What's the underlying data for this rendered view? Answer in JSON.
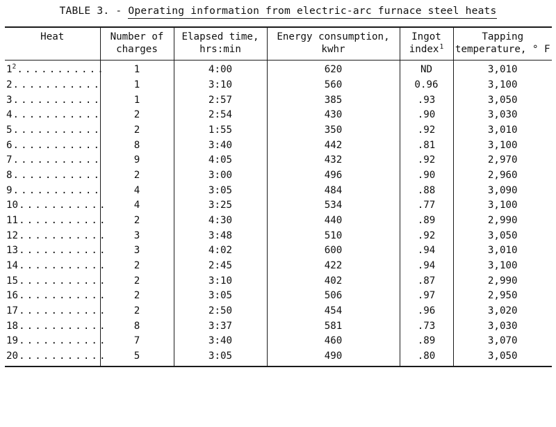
{
  "caption": {
    "label": "TABLE 3. -",
    "title": "Operating information from electric-arc furnace steel heats"
  },
  "table": {
    "columns": [
      {
        "key": "heat",
        "header_line1": "Heat",
        "header_line2": "",
        "footnote": ""
      },
      {
        "key": "charges",
        "header_line1": "Number of",
        "header_line2": "charges",
        "footnote": ""
      },
      {
        "key": "time",
        "header_line1": "Elapsed time,",
        "header_line2": "hrs:min",
        "footnote": ""
      },
      {
        "key": "energy",
        "header_line1": "Energy consumption,",
        "header_line2": "kwhr",
        "footnote": ""
      },
      {
        "key": "ingot",
        "header_line1": "Ingot",
        "header_line2": "index",
        "footnote": "1"
      },
      {
        "key": "temp",
        "header_line1": "Tapping",
        "header_line2": "temperature, ° F",
        "footnote": ""
      }
    ],
    "leader_dots": "...........",
    "rows": [
      {
        "heat": "1",
        "heat_footnote": "2",
        "charges": "1",
        "time": "4:00",
        "energy": "620",
        "ingot": "ND",
        "temp": "3,010"
      },
      {
        "heat": "2",
        "heat_footnote": "",
        "charges": "1",
        "time": "3:10",
        "energy": "560",
        "ingot": "0.96",
        "temp": "3,100"
      },
      {
        "heat": "3",
        "heat_footnote": "",
        "charges": "1",
        "time": "2:57",
        "energy": "385",
        "ingot": ".93",
        "temp": "3,050"
      },
      {
        "heat": "4",
        "heat_footnote": "",
        "charges": "2",
        "time": "2:54",
        "energy": "430",
        "ingot": ".90",
        "temp": "3,030"
      },
      {
        "heat": "5",
        "heat_footnote": "",
        "charges": "2",
        "time": "1:55",
        "energy": "350",
        "ingot": ".92",
        "temp": "3,010"
      },
      {
        "heat": "6",
        "heat_footnote": "",
        "charges": "8",
        "time": "3:40",
        "energy": "442",
        "ingot": ".81",
        "temp": "3,100"
      },
      {
        "heat": "7",
        "heat_footnote": "",
        "charges": "9",
        "time": "4:05",
        "energy": "432",
        "ingot": ".92",
        "temp": "2,970"
      },
      {
        "heat": "8",
        "heat_footnote": "",
        "charges": "2",
        "time": "3:00",
        "energy": "496",
        "ingot": ".90",
        "temp": "2,960"
      },
      {
        "heat": "9",
        "heat_footnote": "",
        "charges": "4",
        "time": "3:05",
        "energy": "484",
        "ingot": ".88",
        "temp": "3,090"
      },
      {
        "heat": "10",
        "heat_footnote": "",
        "charges": "4",
        "time": "3:25",
        "energy": "534",
        "ingot": ".77",
        "temp": "3,100"
      },
      {
        "heat": "11",
        "heat_footnote": "",
        "charges": "2",
        "time": "4:30",
        "energy": "440",
        "ingot": ".89",
        "temp": "2,990"
      },
      {
        "heat": "12",
        "heat_footnote": "",
        "charges": "3",
        "time": "3:48",
        "energy": "510",
        "ingot": ".92",
        "temp": "3,050"
      },
      {
        "heat": "13",
        "heat_footnote": "",
        "charges": "3",
        "time": "4:02",
        "energy": "600",
        "ingot": ".94",
        "temp": "3,010"
      },
      {
        "heat": "14",
        "heat_footnote": "",
        "charges": "2",
        "time": "2:45",
        "energy": "422",
        "ingot": ".94",
        "temp": "3,100"
      },
      {
        "heat": "15",
        "heat_footnote": "",
        "charges": "2",
        "time": "3:10",
        "energy": "402",
        "ingot": ".87",
        "temp": "2,990"
      },
      {
        "heat": "16",
        "heat_footnote": "",
        "charges": "2",
        "time": "3:05",
        "energy": "506",
        "ingot": ".97",
        "temp": "2,950"
      },
      {
        "heat": "17",
        "heat_footnote": "",
        "charges": "2",
        "time": "2:50",
        "energy": "454",
        "ingot": ".96",
        "temp": "3,020"
      },
      {
        "heat": "18",
        "heat_footnote": "",
        "charges": "8",
        "time": "3:37",
        "energy": "581",
        "ingot": ".73",
        "temp": "3,030"
      },
      {
        "heat": "19",
        "heat_footnote": "",
        "charges": "7",
        "time": "3:40",
        "energy": "460",
        "ingot": ".89",
        "temp": "3,070"
      },
      {
        "heat": "20",
        "heat_footnote": "",
        "charges": "5",
        "time": "3:05",
        "energy": "490",
        "ingot": ".80",
        "temp": "3,050"
      }
    ]
  }
}
